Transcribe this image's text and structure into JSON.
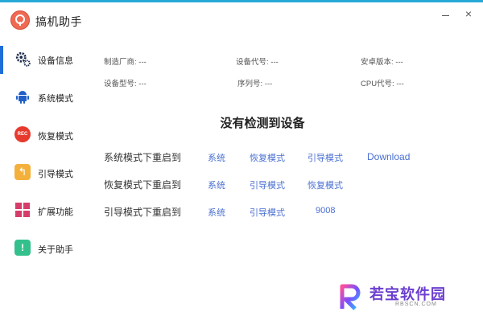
{
  "app": {
    "title": "搞机助手"
  },
  "window": {
    "close_glyph": "×"
  },
  "sidebar": {
    "items": [
      {
        "label": "设备信息",
        "icon": "gear-icon",
        "active": true
      },
      {
        "label": "系统模式",
        "icon": "android-icon"
      },
      {
        "label": "恢复模式",
        "icon": "rec-icon",
        "icon_text": "REC"
      },
      {
        "label": "引导模式",
        "icon": "back-arrow-icon"
      },
      {
        "label": "扩展功能",
        "icon": "grid-icon"
      },
      {
        "label": "关于助手",
        "icon": "info-icon"
      }
    ]
  },
  "device_info": {
    "manufacturer": "制造厂商: ---",
    "codename": "设备代号: ---",
    "android_version": "安卓版本: ---",
    "model": "设备型号: ---",
    "serial": "序列号: ---",
    "cpu": "CPU代号: ---"
  },
  "status": {
    "message": "没有检测到设备"
  },
  "reboot": {
    "system_row": {
      "label": "系统模式下重启到",
      "options": [
        "系统",
        "恢复模式",
        "引导模式",
        "Download"
      ]
    },
    "recovery_row": {
      "label": "恢复模式下重启到",
      "options": [
        "系统",
        "引导模式",
        "恢复模式"
      ]
    },
    "bootloader_row": {
      "label": "引导模式下重启到",
      "options": [
        "系统",
        "引导模式",
        "9008"
      ]
    }
  },
  "watermark": {
    "text": "若宝软件园",
    "subtext": "RBSCN.COM"
  },
  "colors": {
    "accent_bar": "#27a9d8",
    "active_indicator": "#1f6dd6",
    "link": "#4a6fd1"
  }
}
